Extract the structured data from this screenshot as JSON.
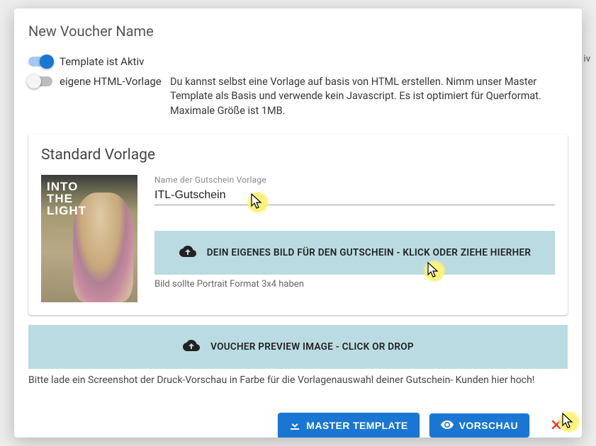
{
  "dialog": {
    "title": "New Voucher Name"
  },
  "toggles": {
    "active": {
      "label": "Template ist Aktiv",
      "on": true
    },
    "custom": {
      "label": "eigene HTML-Vorlage",
      "on": false
    },
    "custom_desc": "Du kannst selbst eine Vorlage auf basis von HTML erstellen. Nimm unser Master Template als Basis und verwende kein Javascript. Es ist optimiert für Querformat. Maximale Größe ist 1MB."
  },
  "card": {
    "title": "Standard Vorlage",
    "thumb_text": "INTO\nTHE\nLIGHT",
    "name_label": "Name der Gutschein Vorlage",
    "name_value": "ITL-Gutschein",
    "upload_text": "DEIN EIGENES BILD FÜR DEN GUTSCHEIN - KLICK ODER ZIEHE HIERHER",
    "upload_hint": "Bild sollte Portrait Format 3x4 haben"
  },
  "preview": {
    "upload_text": "VOUCHER PREVIEW IMAGE - CLICK OR DROP",
    "hint": "Bitte lade ein Screenshot der Druck-Vorschau in Farbe für die Vorlagenauswahl deiner Gutschein- Kunden hier hoch!"
  },
  "footer": {
    "master_template": "MASTER TEMPLATE",
    "preview_btn": "VORSCHAU"
  },
  "bg": {
    "right_chip": "iv"
  },
  "icons": {
    "cloud_upload": "cloud-upload-icon",
    "download": "download-icon",
    "eye": "eye-icon",
    "close": "close-icon"
  }
}
